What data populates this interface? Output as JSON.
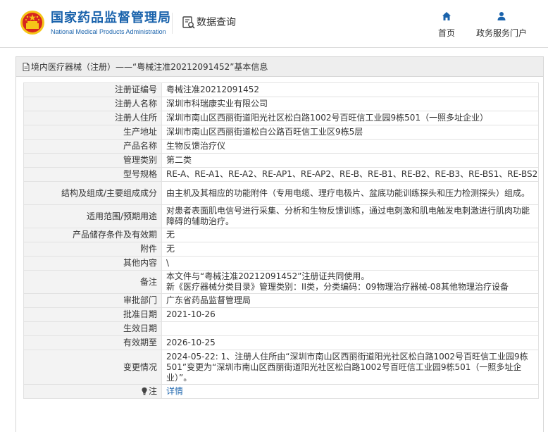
{
  "header": {
    "brand_cn": "国家药品监督管理局",
    "brand_en": "National Medical Products Administration",
    "query_label": "数据查询",
    "nav": {
      "home_label": "首页",
      "portal_label": "政务服务门户"
    }
  },
  "panel": {
    "title_prefix": "境内医疗器械（注册）",
    "title_separator": " —— ",
    "title_record": "“粤械注准20212091452”基本信息"
  },
  "table": {
    "rows": [
      {
        "label": "注册证编号",
        "value": "粤械注准20212091452"
      },
      {
        "label": "注册人名称",
        "value": "深圳市科瑞康实业有限公司"
      },
      {
        "label": "注册人住所",
        "value": "深圳市南山区西丽街道阳光社区松白路1002号百旺信工业园9栋501（一照多址企业）"
      },
      {
        "label": "生产地址",
        "value": "深圳市南山区西丽街道松白公路百旺信工业区9栋5层"
      },
      {
        "label": "产品名称",
        "value": "生物反馈治疗仪"
      },
      {
        "label": "管理类别",
        "value": "第二类"
      },
      {
        "label": "型号规格",
        "value": "RE-A、RE-A1、RE-A2、RE-AP1、RE-AP2、RE-B、RE-B1、RE-B2、RE-B3、RE-BS1、RE-BS2"
      },
      {
        "label": "结构及组成/主要组成成分",
        "value": "由主机及其相应的功能附件（专用电缆、理疗电极片、盆底功能训练探头和压力检测探头）组成。"
      },
      {
        "label": "适用范围/预期用途",
        "value": "对患者表面肌电信号进行采集、分析和生物反馈训练，通过电刺激和肌电触发电刺激进行肌肉功能障碍的辅助治疗。"
      },
      {
        "label": "产品储存条件及有效期",
        "value": "无"
      },
      {
        "label": "附件",
        "value": "无"
      },
      {
        "label": "其他内容",
        "value": "\\"
      },
      {
        "label": "备注",
        "value_line1": "本文件与“粤械注准20212091452”注册证共同使用。",
        "value_line2": "新《医疗器械分类目录》管理类别：II类，分类编码：09物理治疗器械-08其他物理治疗设备"
      },
      {
        "label": "审批部门",
        "value": "广东省药品监督管理局"
      },
      {
        "label": "批准日期",
        "value": "2021-10-26"
      },
      {
        "label": "生效日期",
        "value": ""
      },
      {
        "label": "有效期至",
        "value": "2026-10-25"
      },
      {
        "label": "变更情况",
        "value": "2024-05-22: 1、注册人住所由“深圳市南山区西丽街道阳光社区松白路1002号百旺信工业园9栋501”变更为“深圳市南山区西丽街道阳光社区松白路1002号百旺信工业园9栋501（一照多址企业）”。"
      },
      {
        "label": "注",
        "value": "详情"
      }
    ]
  },
  "colors": {
    "brand_blue": "#1a63ac",
    "emblem_red": "#d7261f",
    "emblem_gold": "#f5c518",
    "label_bg": "#f3f3f3",
    "title_bg": "#eeeeee"
  },
  "icons": {
    "emblem": "national-emblem-icon",
    "query": "data-query-icon",
    "home": "home-icon",
    "portal": "user-icon",
    "doc": "document-icon",
    "note": "lightbulb-icon"
  }
}
